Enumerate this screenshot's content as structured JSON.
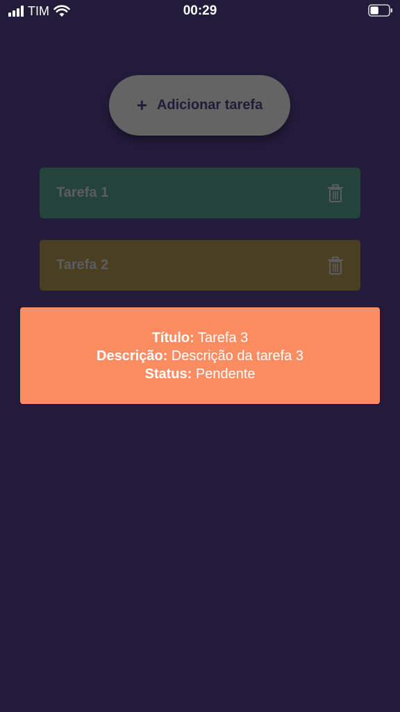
{
  "status_bar": {
    "carrier": "TIM",
    "time": "00:29",
    "battery_level": 0.45
  },
  "add_button": {
    "icon": "+",
    "label": "Adicionar tarefa"
  },
  "tasks": [
    {
      "title": "Tarefa 1",
      "color": "#23433b"
    },
    {
      "title": "Tarefa 2",
      "color": "#4b3f22"
    }
  ],
  "detail": {
    "title_label": "Título:",
    "title_value": "Tarefa 3",
    "description_label": "Descrição:",
    "description_value": "Descrição da tarefa 3",
    "status_label": "Status:",
    "status_value": "Pendente",
    "color": "#fc8d63"
  },
  "colors": {
    "background": "#221b3a",
    "add_button": "#646464"
  }
}
